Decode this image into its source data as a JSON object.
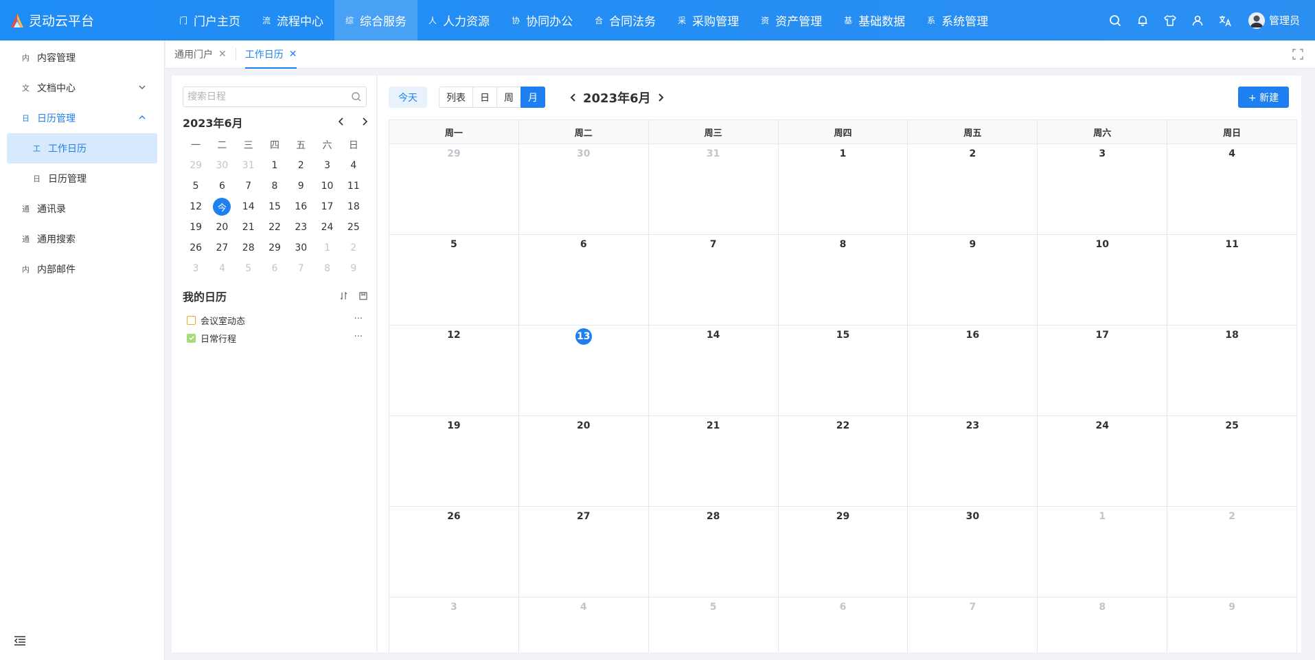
{
  "brand": {
    "name": "灵动云平台"
  },
  "nav": [
    {
      "icon": "门",
      "label": "门户主页"
    },
    {
      "icon": "流",
      "label": "流程中心"
    },
    {
      "icon": "综",
      "label": "综合服务"
    },
    {
      "icon": "人",
      "label": "人力资源"
    },
    {
      "icon": "协",
      "label": "协同办公"
    },
    {
      "icon": "合",
      "label": "合同法务"
    },
    {
      "icon": "采",
      "label": "采购管理"
    },
    {
      "icon": "资",
      "label": "资产管理"
    },
    {
      "icon": "基",
      "label": "基础数据"
    },
    {
      "icon": "系",
      "label": "系统管理"
    }
  ],
  "user": {
    "name": "管理员"
  },
  "sidebar": [
    {
      "icon": "内",
      "label": "内容管理"
    },
    {
      "icon": "文",
      "label": "文档中心"
    },
    {
      "icon": "日",
      "label": "日历管理"
    },
    {
      "icon": "工",
      "label": "工作日历"
    },
    {
      "icon": "日",
      "label": "日历管理"
    },
    {
      "icon": "通",
      "label": "通讯录"
    },
    {
      "icon": "通",
      "label": "通用搜索"
    },
    {
      "icon": "内",
      "label": "内部邮件"
    }
  ],
  "tabs": [
    {
      "label": "通用门户"
    },
    {
      "label": "工作日历"
    }
  ],
  "search": {
    "placeholder": "搜索日程"
  },
  "mini_calendar": {
    "title": "2023年6月",
    "weekdays": [
      "一",
      "二",
      "三",
      "四",
      "五",
      "六",
      "日"
    ],
    "today_label": "今",
    "weeks": [
      [
        "29",
        "30",
        "31",
        "1",
        "2",
        "3",
        "4"
      ],
      [
        "5",
        "6",
        "7",
        "8",
        "9",
        "10",
        "11"
      ],
      [
        "12",
        "今",
        "14",
        "15",
        "16",
        "17",
        "18"
      ],
      [
        "19",
        "20",
        "21",
        "22",
        "23",
        "24",
        "25"
      ],
      [
        "26",
        "27",
        "28",
        "29",
        "30",
        "1",
        "2"
      ],
      [
        "3",
        "4",
        "5",
        "6",
        "7",
        "8",
        "9"
      ]
    ]
  },
  "my_calendars": {
    "title": "我的日历",
    "items": [
      {
        "label": "会议室动态",
        "checked": false,
        "color": "#f5a623"
      },
      {
        "label": "日常行程",
        "checked": true,
        "color": "#a7dc7a"
      }
    ]
  },
  "toolbar": {
    "today": "今天",
    "views": [
      "列表",
      "日",
      "周",
      "月"
    ],
    "active_view": "月",
    "title": "2023年6月",
    "new": "+ 新建"
  },
  "month_grid": {
    "weekdays": [
      "周一",
      "周二",
      "周三",
      "周四",
      "周五",
      "周六",
      "周日"
    ],
    "weeks": [
      [
        "29",
        "30",
        "31",
        "1",
        "2",
        "3",
        "4"
      ],
      [
        "5",
        "6",
        "7",
        "8",
        "9",
        "10",
        "11"
      ],
      [
        "12",
        "13",
        "14",
        "15",
        "16",
        "17",
        "18"
      ],
      [
        "19",
        "20",
        "21",
        "22",
        "23",
        "24",
        "25"
      ],
      [
        "26",
        "27",
        "28",
        "29",
        "30",
        "1",
        "2"
      ],
      [
        "3",
        "4",
        "5",
        "6",
        "7",
        "8",
        "9"
      ]
    ],
    "today": "13"
  },
  "colors": {
    "accent": "#1e80f0",
    "topbar": "#1e8cf5"
  }
}
